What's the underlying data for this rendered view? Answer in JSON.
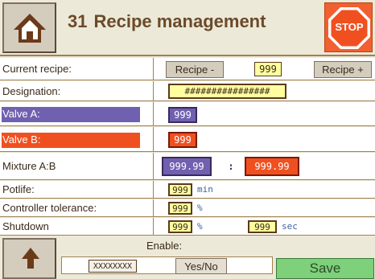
{
  "header": {
    "screen_number": "31",
    "title": "Recipe management",
    "stop_label": "STOP"
  },
  "rows": {
    "current_recipe": {
      "label": "Current recipe:",
      "prev_button": "Recipe -",
      "value": "999",
      "next_button": "Recipe +"
    },
    "designation": {
      "label": "Designation:",
      "value": "################"
    },
    "valve_a": {
      "label": "Valve A:",
      "value": "999"
    },
    "valve_b": {
      "label": "Valve B:",
      "value": "999"
    },
    "mixture": {
      "label": "Mixture A:B",
      "value_a": "999.99",
      "separator": ":",
      "value_b": "999.99"
    },
    "potlife": {
      "label": "Potlife:",
      "value": "999",
      "unit": "min"
    },
    "tolerance": {
      "label": "Controller tolerance:",
      "value": "999",
      "unit": "%"
    },
    "shutdown": {
      "label": "Shutdown",
      "value": "999",
      "unit": "%",
      "value2": "999",
      "unit2": "sec"
    }
  },
  "bottom": {
    "enable_label": "Enable:",
    "enable_value": "XXXXXXXX",
    "yesno_button": "Yes/No",
    "save_button": "Save"
  },
  "colors": {
    "valve_a": "#7060b0",
    "valve_b": "#f05020",
    "save": "#7ed07a",
    "stop": "#f06030"
  }
}
